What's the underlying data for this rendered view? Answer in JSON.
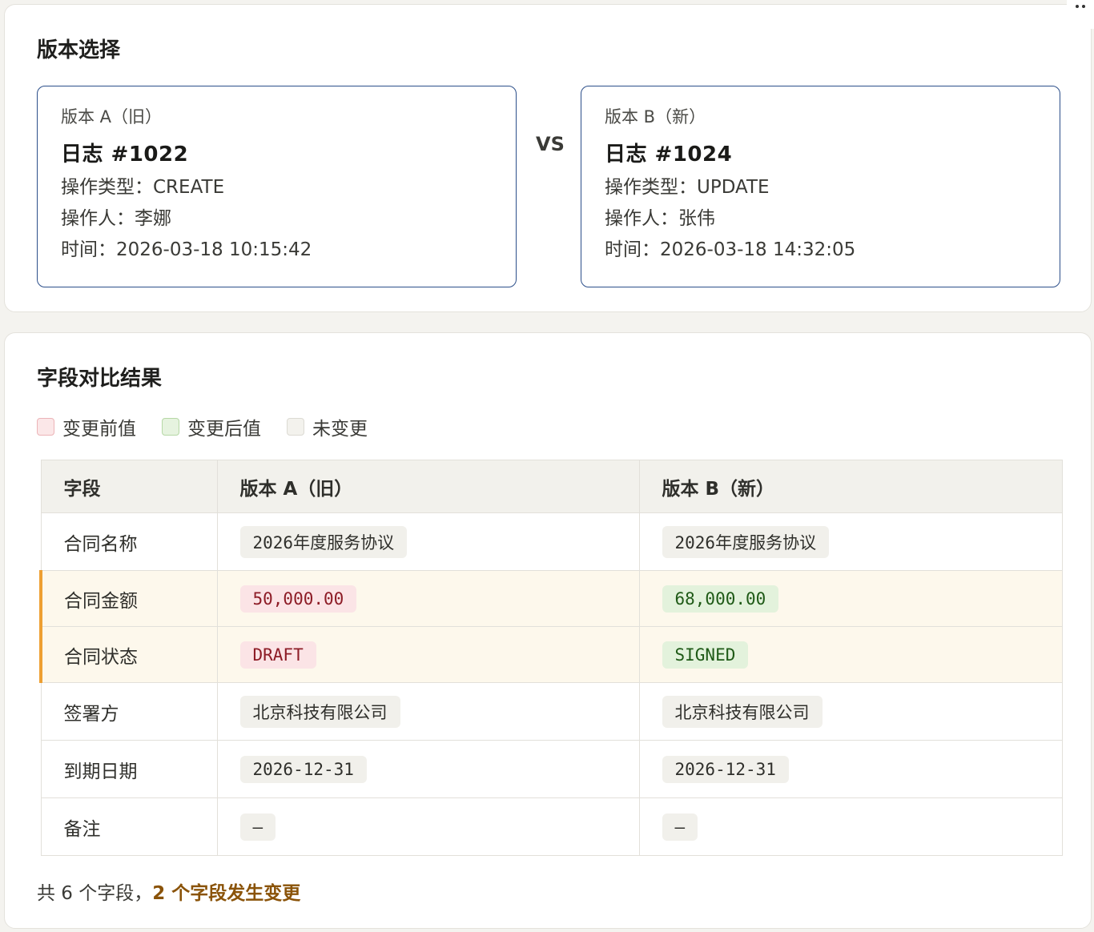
{
  "version_select": {
    "title": "版本选择",
    "vs": "VS",
    "version_a": {
      "label": "版本 A（旧）",
      "title": "日志  #1022",
      "op_type": "操作类型：CREATE",
      "operator": "操作人：李娜",
      "time": "时间：2026-03-18 10:15:42"
    },
    "version_b": {
      "label": "版本 B（新）",
      "title": "日志  #1024",
      "op_type": "操作类型：UPDATE",
      "operator": "操作人：张伟",
      "time": "时间：2026-03-18 14:32:05"
    }
  },
  "diff": {
    "title": "字段对比结果",
    "legend": [
      {
        "label": "变更前值",
        "fill": "#fbe7e8",
        "border": "#ecb3b7"
      },
      {
        "label": "变更后值",
        "fill": "#e6f3df",
        "border": "#b6d8a6"
      },
      {
        "label": "未变更",
        "fill": "#f3f2ed",
        "border": "#dcdad3"
      }
    ],
    "headers": {
      "field": "字段",
      "a": "版本 A（旧）",
      "b": "版本 B（新）"
    },
    "rows": [
      {
        "field": "合同名称",
        "a": "2026年度服务协议",
        "b": "2026年度服务协议",
        "changed": false
      },
      {
        "field": "合同金额",
        "a": "50,000.00",
        "b": "68,000.00",
        "changed": true
      },
      {
        "field": "合同状态",
        "a": "DRAFT",
        "b": "SIGNED",
        "changed": true
      },
      {
        "field": "签署方",
        "a": "北京科技有限公司",
        "b": "北京科技有限公司",
        "changed": false
      },
      {
        "field": "到期日期",
        "a": "2026-12-31",
        "b": "2026-12-31",
        "changed": false
      },
      {
        "field": "备注",
        "a": "—",
        "b": "—",
        "changed": false
      }
    ],
    "summary_prefix": "共 6 个字段，",
    "summary_highlight": "2 个字段发生变更"
  },
  "colors": {
    "changed_accent": "#ee9f32",
    "version_border": "#2c4f8a"
  },
  "icons": {
    "corner_menu": "more-dots-icon"
  }
}
